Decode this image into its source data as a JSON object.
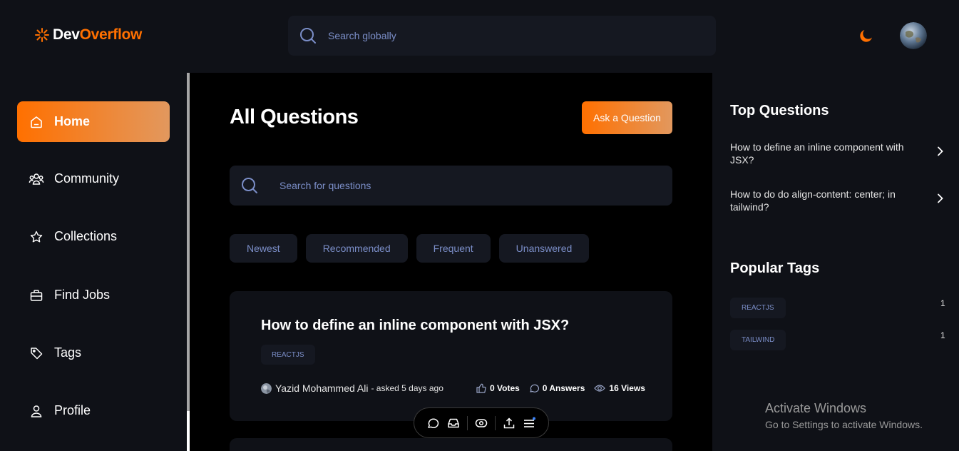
{
  "header": {
    "logo_part1": "Dev",
    "logo_part2": "Overflow",
    "search_placeholder": "Search globally",
    "accent": "#ff7000"
  },
  "sidebar": {
    "items": [
      {
        "label": "Home",
        "icon": "home-icon",
        "active": true
      },
      {
        "label": "Community",
        "icon": "community-icon"
      },
      {
        "label": "Collections",
        "icon": "star-icon"
      },
      {
        "label": "Find Jobs",
        "icon": "briefcase-icon"
      },
      {
        "label": "Tags",
        "icon": "tag-icon"
      },
      {
        "label": "Profile",
        "icon": "user-icon"
      }
    ]
  },
  "main": {
    "title": "All Questions",
    "ask_button": "Ask a Question",
    "search_placeholder": "Search for questions",
    "filters": [
      "Newest",
      "Recommended",
      "Frequent",
      "Unanswered"
    ],
    "questions": [
      {
        "title": "How to define an inline component with JSX?",
        "tags": [
          "REACTJS"
        ],
        "author": "Yazid Mohammed Ali",
        "asked": "- asked 5 days ago",
        "votes": "0 Votes",
        "answers": "0 Answers",
        "views": "16 Views"
      }
    ]
  },
  "right": {
    "top_questions_title": "Top Questions",
    "top_questions": [
      "How to define an inline component with JSX?",
      "How to do do align-content: center; in tailwind?"
    ],
    "popular_tags_title": "Popular Tags",
    "popular_tags": [
      {
        "name": "REACTJS",
        "count": "1"
      },
      {
        "name": "TAILWIND",
        "count": "1"
      }
    ]
  },
  "overlay": {
    "activate_title": "Activate Windows",
    "activate_sub": "Go to Settings to activate Windows."
  }
}
